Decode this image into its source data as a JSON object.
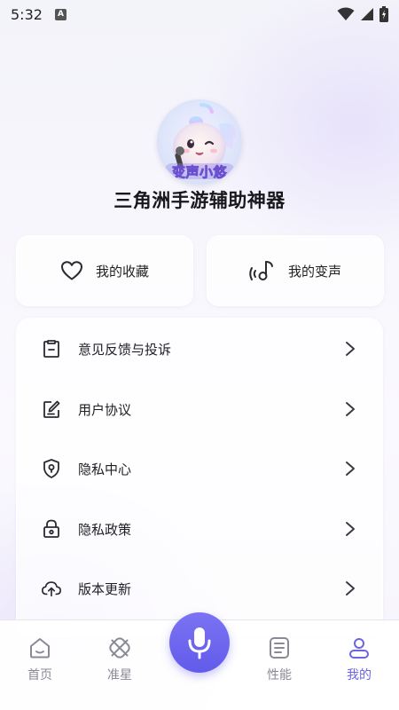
{
  "status_bar": {
    "time": "5:32",
    "notification_icon": "A"
  },
  "profile": {
    "avatar_text": "变声小悠",
    "app_title": "三角洲手游辅助神器"
  },
  "quick_actions": [
    {
      "label": "我的收藏",
      "icon": "heart-icon"
    },
    {
      "label": "我的变声",
      "icon": "music-note-icon"
    }
  ],
  "menu": [
    {
      "label": "意见反馈与投诉",
      "icon": "feedback-clipboard-icon"
    },
    {
      "label": "用户协议",
      "icon": "edit-document-icon"
    },
    {
      "label": "隐私中心",
      "icon": "shield-icon"
    },
    {
      "label": "隐私政策",
      "icon": "lock-icon"
    },
    {
      "label": "版本更新",
      "icon": "cloud-upload-icon"
    }
  ],
  "bottom_nav": [
    {
      "label": "首页",
      "icon": "home-icon",
      "active": false
    },
    {
      "label": "准星",
      "icon": "crosshair-icon",
      "active": false
    },
    {
      "label": "性能",
      "icon": "performance-icon",
      "active": false
    },
    {
      "label": "我的",
      "icon": "profile-icon",
      "active": true
    }
  ],
  "colors": {
    "accent": "#6b64e8",
    "mic_button": "#6d66ee",
    "inactive_nav": "#8a8a96"
  }
}
